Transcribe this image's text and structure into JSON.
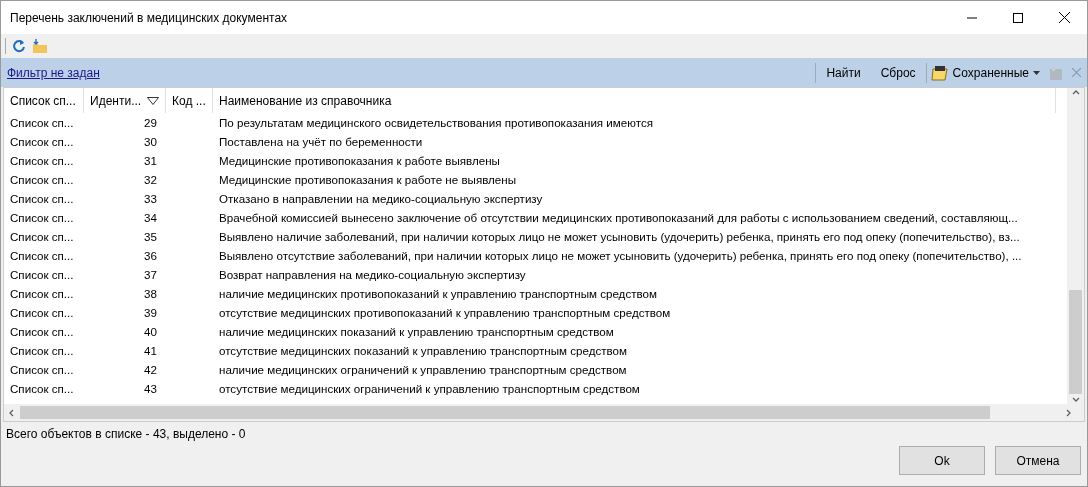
{
  "window": {
    "title": "Перечень заключений в медицинских документах"
  },
  "filter": {
    "link": "Фильтр не задан",
    "buttons": [
      "Найти",
      "Сброс"
    ],
    "saved": "Сохраненные"
  },
  "table": {
    "columns": [
      {
        "label": "Список сп...",
        "sorted": false
      },
      {
        "label": "Иденти...",
        "sorted": true
      },
      {
        "label": "Код ...",
        "sorted": false
      },
      {
        "label": "Наименование из справочника",
        "sorted": false
      }
    ],
    "rows": [
      [
        "Список сп...",
        "29",
        "",
        "По результатам медицинского освидетельствования противопоказания имеются"
      ],
      [
        "Список сп...",
        "30",
        "",
        "Поставлена на учёт по беременности"
      ],
      [
        "Список сп...",
        "31",
        "",
        "Медицинские противопоказания к работе выявлены"
      ],
      [
        "Список сп...",
        "32",
        "",
        "Медицинские противопоказания к работе не выявлены"
      ],
      [
        "Список сп...",
        "33",
        "",
        "Отказано в направлении на медико-социальную экспертизу"
      ],
      [
        "Список сп...",
        "34",
        "",
        "Врачебной комиссией вынесено заключение об отсутствии медицинских противопоказаний для работы с использованием сведений, составляющ..."
      ],
      [
        "Список сп...",
        "35",
        "",
        "Выявлено наличие заболеваний, при наличии которых лицо не может усыновить (удочерить) ребенка, принять его под опеку (попечительство), вз..."
      ],
      [
        "Список сп...",
        "36",
        "",
        "Выявлено отсутствие заболеваний, при наличии которых лицо не может усыновить (удочерить) ребенка, принять его под опеку (попечительство), ..."
      ],
      [
        "Список сп...",
        "37",
        "",
        "Возврат направления на медико-социальную экспертизу"
      ],
      [
        "Список сп...",
        "38",
        "",
        "наличие медицинских противопоказаний к управлению транспортным средством"
      ],
      [
        "Список сп...",
        "39",
        "",
        "отсутствие медицинских противопоказаний к управлению транспортным средством"
      ],
      [
        "Список сп...",
        "40",
        "",
        "наличие медицинских показаний к управлению транспортным средством"
      ],
      [
        "Список сп...",
        "41",
        "",
        "отсутствие медицинских показаний к управлению транспортным средством"
      ],
      [
        "Список сп...",
        "42",
        "",
        "наличие медицинских ограничений к управлению транспортным средством"
      ],
      [
        "Список сп...",
        "43",
        "",
        "отсутствие медицинских ограничений к управлению транспортным средством"
      ]
    ]
  },
  "status_bar": "Всего объектов в списке - 43, выделено - 0",
  "buttons": [
    "Ok",
    "Отмена"
  ]
}
